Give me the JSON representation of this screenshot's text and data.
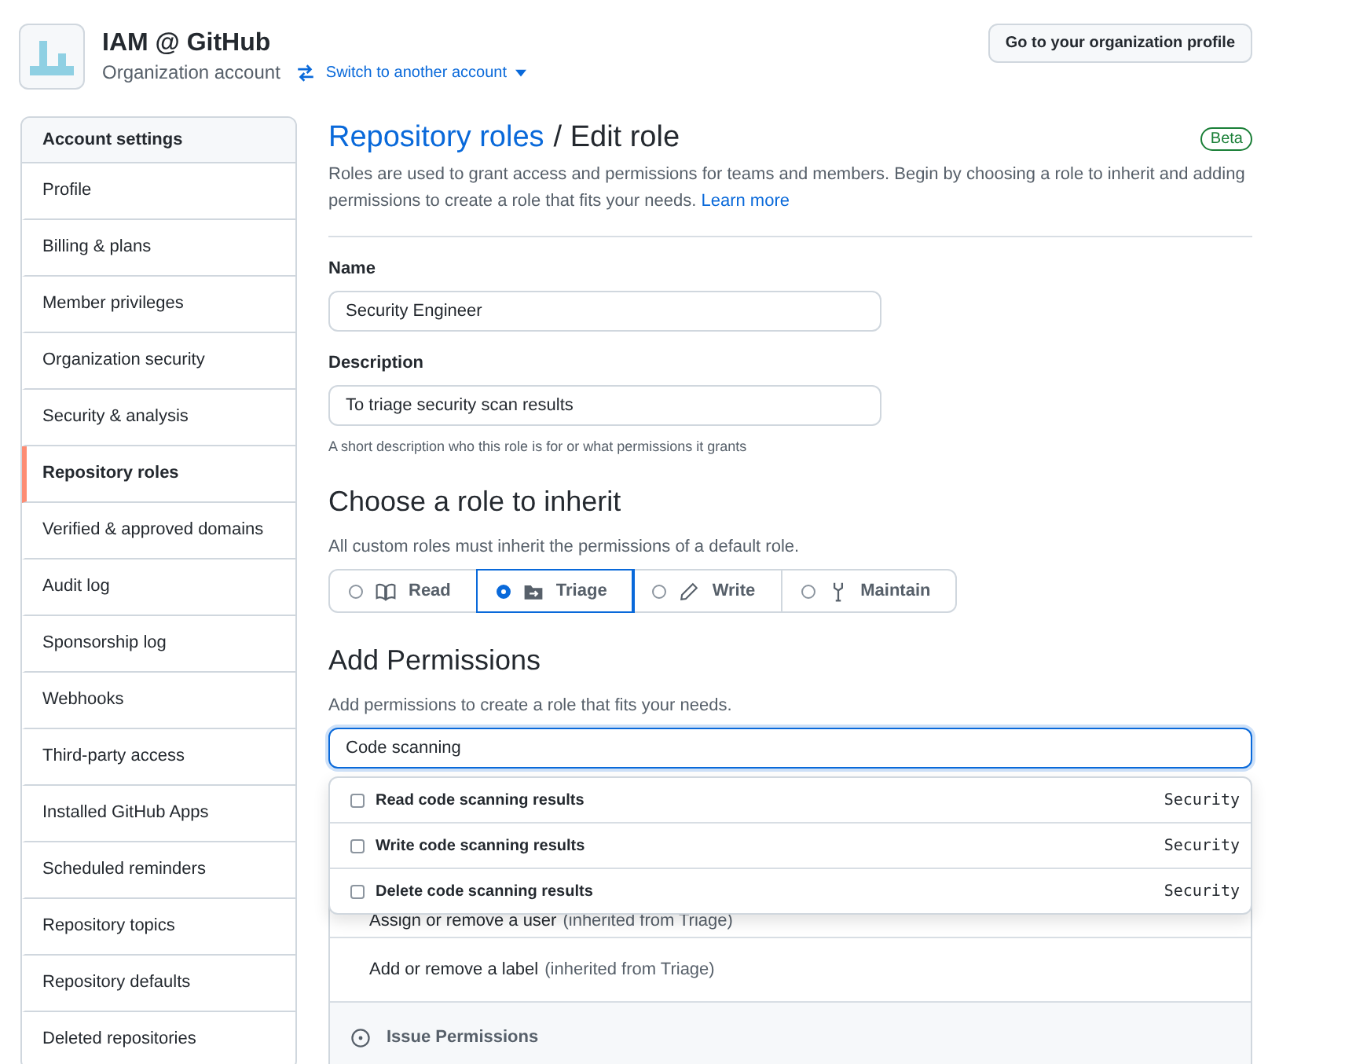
{
  "header": {
    "org_name": "IAM @ GitHub",
    "account_type": "Organization account",
    "switch_link": "Switch to another account",
    "profile_button": "Go to your organization profile"
  },
  "sidebar": {
    "heading": "Account settings",
    "items": [
      {
        "label": "Profile",
        "selected": false
      },
      {
        "label": "Billing & plans",
        "selected": false
      },
      {
        "label": "Member privileges",
        "selected": false
      },
      {
        "label": "Organization security",
        "selected": false
      },
      {
        "label": "Security & analysis",
        "selected": false
      },
      {
        "label": "Repository roles",
        "selected": true
      },
      {
        "label": "Verified & approved domains",
        "selected": false
      },
      {
        "label": "Audit log",
        "selected": false
      },
      {
        "label": "Sponsorship log",
        "selected": false
      },
      {
        "label": "Webhooks",
        "selected": false
      },
      {
        "label": "Third-party access",
        "selected": false
      },
      {
        "label": "Installed GitHub Apps",
        "selected": false
      },
      {
        "label": "Scheduled reminders",
        "selected": false
      },
      {
        "label": "Repository topics",
        "selected": false
      },
      {
        "label": "Repository defaults",
        "selected": false
      },
      {
        "label": "Deleted repositories",
        "selected": false
      }
    ]
  },
  "main": {
    "breadcrumb_link": "Repository roles",
    "title": "/ Edit role",
    "badge": "Beta",
    "intro": "Roles are used to grant access and permissions for teams and members. Begin by choosing a role to inherit and adding permissions to create a role that fits your needs.",
    "learn_more": "Learn more",
    "name_label": "Name",
    "name_value": "Security Engineer",
    "description_label": "Description",
    "description_value": "To triage security scan results",
    "description_hint": "A short description who this role is for or what permissions it grants",
    "inherit_heading": "Choose a role to inherit",
    "inherit_hint": "All custom roles must inherit the permissions of a default role.",
    "roles": [
      {
        "label": "Read",
        "kind": "book",
        "selected": false
      },
      {
        "label": "Triage",
        "kind": "folder",
        "selected": true
      },
      {
        "label": "Write",
        "kind": "pencil",
        "selected": false
      },
      {
        "label": "Maintain",
        "kind": "tool",
        "selected": false
      }
    ],
    "permissions_heading": "Add Permissions",
    "permissions_hint": "Add permissions to create a role that fits your needs.",
    "search_value": "Code scanning",
    "suggestions": [
      {
        "label": "Read code scanning results",
        "category": "Security",
        "checked": false
      },
      {
        "label": "Write code scanning results",
        "category": "Security",
        "checked": false
      },
      {
        "label": "Delete code scanning results",
        "category": "Security",
        "checked": false
      }
    ],
    "inherited": [
      {
        "label": "Assign or remove a user",
        "note": "(inherited from Triage)"
      },
      {
        "label": "Add or remove a label",
        "note": "(inherited from Triage)"
      }
    ],
    "group_heading": "Issue Permissions"
  }
}
